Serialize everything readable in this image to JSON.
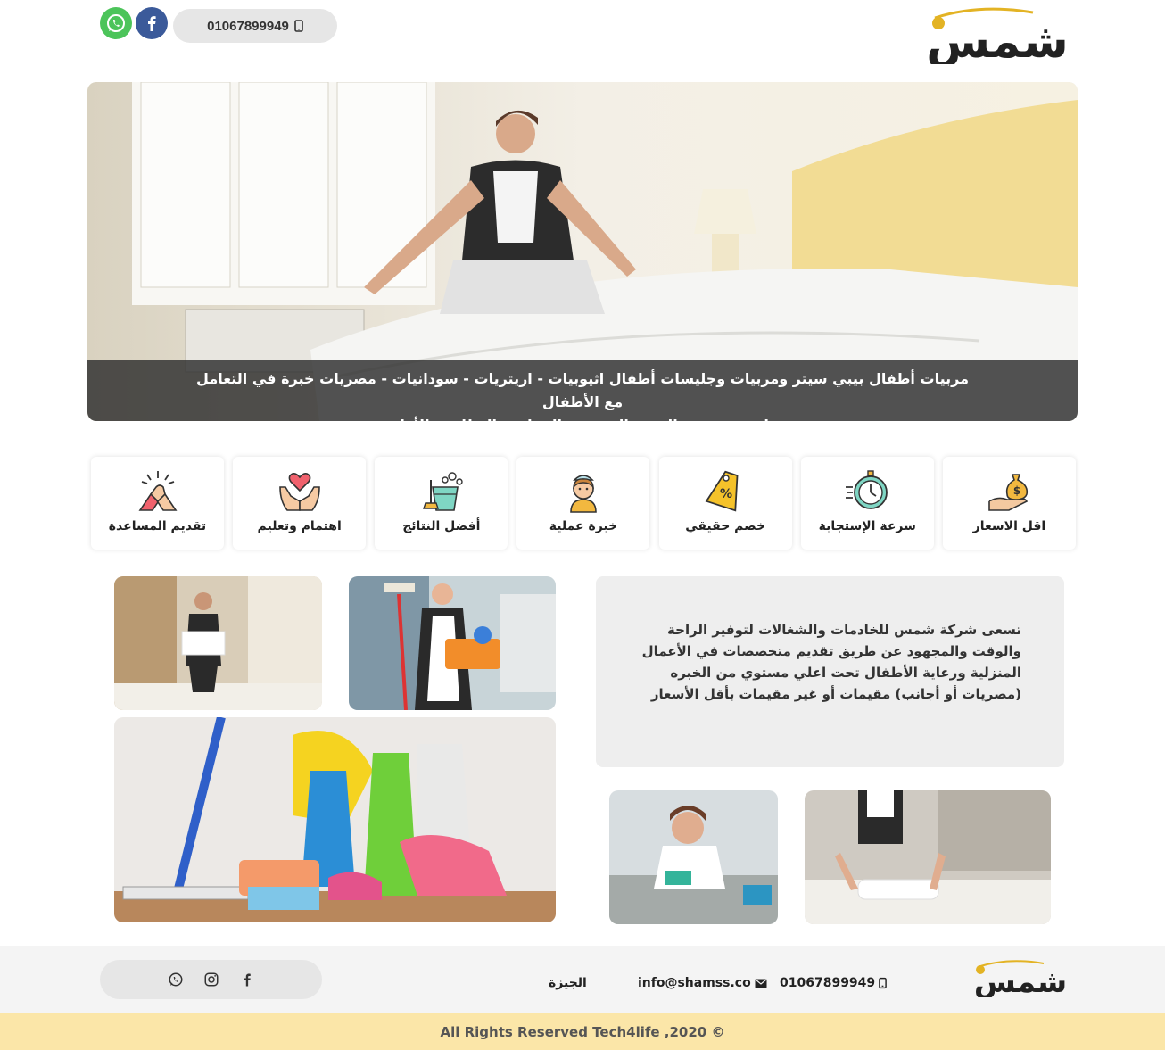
{
  "header": {
    "phone": "01067899949",
    "logo_text": "شمس",
    "icons": [
      "whatsapp-icon",
      "facebook-icon",
      "phone-icon"
    ]
  },
  "hero": {
    "caption_line1": "مربيات أطفال بيبي سيتر ومربيات وجليسات أطفال اثيوبيات - اريتريات - سودانيات - مصريات خبرة في التعامل مع الأطفال",
    "caption_line2": "على مستوى عالٍ من التدريب والمهارة والنظافة والأمانة"
  },
  "features": [
    {
      "label": "اقل الاسعار",
      "icon": "money-bag-hand-icon"
    },
    {
      "label": "سرعة الإستجابة",
      "icon": "stopwatch-icon"
    },
    {
      "label": "خصم حقيقي",
      "icon": "discount-tag-icon"
    },
    {
      "label": "خبرة عملية",
      "icon": "maid-icon"
    },
    {
      "label": "أفضل النتائج",
      "icon": "cleaning-bucket-icon"
    },
    {
      "label": "اهتمام وتعليم",
      "icon": "heart-hands-icon"
    },
    {
      "label": "تقديم المساعدة",
      "icon": "handshake-icon"
    }
  ],
  "about": {
    "text": "تسعى شركة شمس للخادمات والشغالات لتوفير الراحة والوقت والمجهود عن طريق تقديم متخصصات في الأعمال المنزلية ورعاية الأطفال تحت اعلي مستوي من الخبره (مصريات أو أجانب) مقيمات أو غير مقيمات بأقل الأسعار"
  },
  "footer": {
    "phone": "01067899949",
    "email": "info@shamss.co",
    "city": "الجيزة",
    "logo_text": "شمس",
    "social_icons": [
      "facebook-icon",
      "instagram-icon",
      "whatsapp-icon"
    ]
  },
  "copyright": "All Rights Reserved Tech4life ,2020 ©",
  "colors": {
    "whatsapp": "#4cc45a",
    "facebook": "#3b5a9a",
    "footer_bar": "#fbe6a8",
    "logo_gold": "#e3b324"
  }
}
